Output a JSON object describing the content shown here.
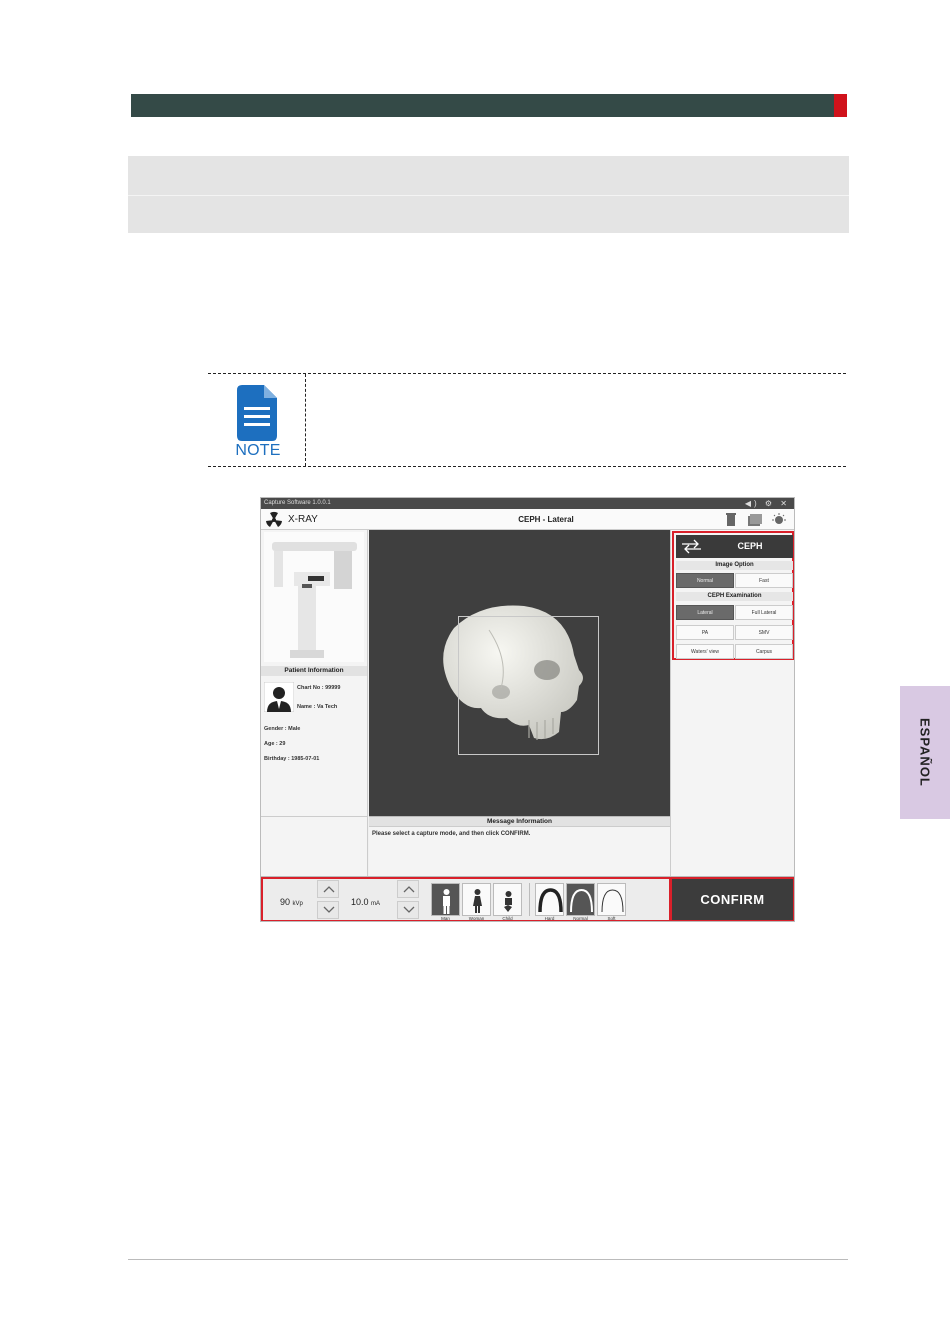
{
  "side_tab": {
    "label": "ESPAÑOL"
  },
  "note": {
    "label": "NOTE"
  },
  "screenshot": {
    "window_title": "Capture Software 1.0.0.1",
    "app_label": "X-RAY",
    "mode_title": "CEPH - Lateral",
    "patient": {
      "header": "Patient Information",
      "chart_no": "Chart No : 99999",
      "name": "Name : Va Tech",
      "gender": "Gender : Male",
      "age": "Age : 29",
      "birthday": "Birthday : 1985-07-01"
    },
    "message": {
      "header": "Message Information",
      "text": "Please select a capture mode, and then click CONFIRM."
    },
    "mode_button": "CEPH",
    "image_option": {
      "header": "Image Option",
      "options": [
        "Normal",
        "Fast"
      ],
      "selected": "Normal"
    },
    "ceph_exam": {
      "header": "CEPH Examination",
      "options": [
        "Lateral",
        "Full Lateral",
        "PA",
        "SMV",
        "Waters' view",
        "Carpus"
      ],
      "selected": "Lateral"
    },
    "kvp": {
      "value": "90",
      "unit": "kVp"
    },
    "ma": {
      "value": "10.0",
      "unit": "mA"
    },
    "patient_sizes": [
      "Man",
      "Woman",
      "Child"
    ],
    "selected_size": "Man",
    "intensity": [
      "Hard",
      "Normal",
      "Soft"
    ],
    "selected_intensity": "Normal",
    "confirm_label": "CONFIRM"
  },
  "colors": {
    "header_bar": "#344a47",
    "header_accent": "#d0121b",
    "highlight": "#d9202a",
    "note_blue": "#1d6fbf",
    "side_tab": "#d9c9e3"
  }
}
